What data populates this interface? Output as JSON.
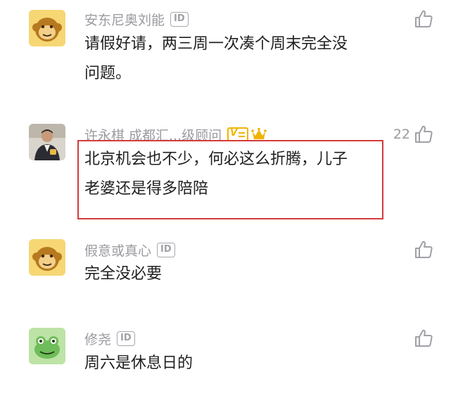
{
  "comments": [
    {
      "author": "安东尼奥刘能",
      "id_badge": "ID",
      "text_lines": [
        "请假好请，两三周一次凑个周末完全没",
        "问题。"
      ],
      "avatar": "monkey-avatar-icon",
      "like_count": ""
    },
    {
      "author": "许永棋 成都汇...级顾问",
      "id_badge": "",
      "text_lines": [
        "北京机会也不少，何必这么折腾，儿子",
        "老婆还是得多陪陪"
      ],
      "avatar": "person-photo-avatar",
      "like_count": "22",
      "highlighted": true
    },
    {
      "author": "假意或真心",
      "id_badge": "ID",
      "text_lines": [
        "完全没必要"
      ],
      "avatar": "monkey-avatar-icon",
      "like_count": ""
    },
    {
      "author": "修尧",
      "id_badge": "ID",
      "text_lines": [
        "周六是休息日的"
      ],
      "avatar": "frog-avatar-icon",
      "like_count": ""
    }
  ],
  "colors": {
    "highlight_border": "#d43b3b",
    "meta_gray": "#9a9aa0",
    "verified_gold": "#f0b400"
  },
  "badges": {
    "verified_label": "V"
  }
}
